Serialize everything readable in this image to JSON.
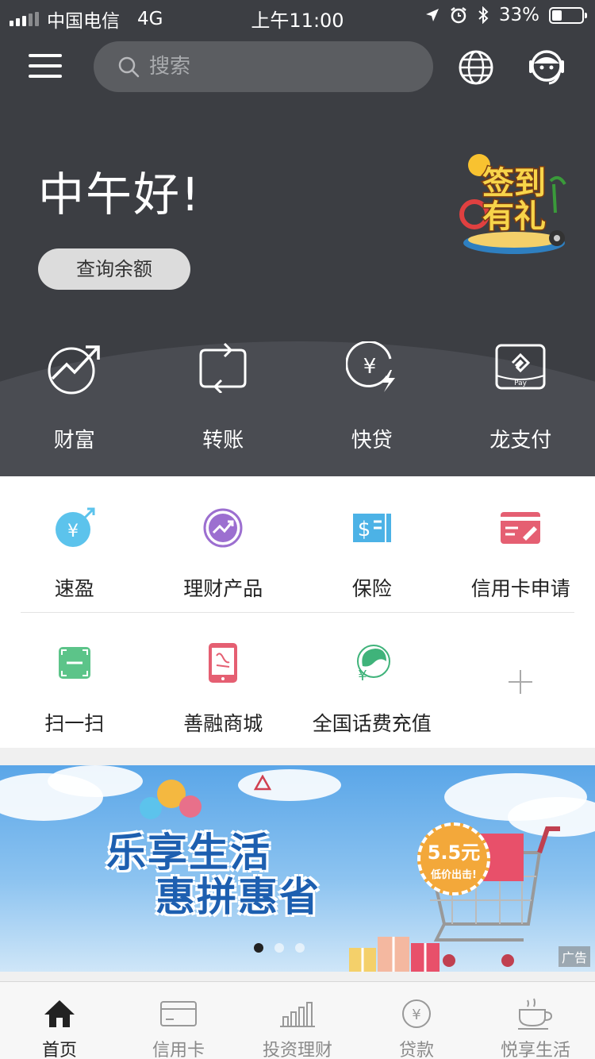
{
  "status_bar": {
    "carrier": "中国电信",
    "network": "4G",
    "time": "上午11:00",
    "battery": "33%",
    "battery_level": 0.33
  },
  "header": {
    "search_placeholder": "搜索"
  },
  "greeting": "中午好!",
  "balance_button": "查询余额",
  "promo_badge": {
    "line1": "签到",
    "line2": "有礼"
  },
  "quick_actions": [
    {
      "label": "财富",
      "icon": "wealth-chart-icon"
    },
    {
      "label": "转账",
      "icon": "transfer-icon"
    },
    {
      "label": "快贷",
      "icon": "quick-loan-icon"
    },
    {
      "label": "龙支付",
      "icon": "long-pay-icon"
    }
  ],
  "services": [
    {
      "label": "速盈",
      "icon": "quick-profit-icon",
      "color": "#5cc3ec"
    },
    {
      "label": "理财产品",
      "icon": "wealth-product-icon",
      "color": "#9c6fd0"
    },
    {
      "label": "保险",
      "icon": "insurance-icon",
      "color": "#4cb2e6"
    },
    {
      "label": "信用卡申请",
      "icon": "credit-card-apply-icon",
      "color": "#e55f72"
    },
    {
      "label": "扫一扫",
      "icon": "scan-icon",
      "color": "#5cc489"
    },
    {
      "label": "善融商城",
      "icon": "shanrong-mall-icon",
      "color": "#e55f72"
    },
    {
      "label": "全国话费充值",
      "icon": "phone-recharge-icon",
      "color": "#3fb37a"
    }
  ],
  "banner": {
    "title_line1": "乐享生活",
    "title_line2": "惠拼惠省",
    "price_big": "5.5元",
    "price_small": "低价出击!",
    "ad_label": "广告"
  },
  "tabbar": [
    {
      "label": "首页",
      "icon": "home-icon",
      "active": true
    },
    {
      "label": "信用卡",
      "icon": "credit-card-icon",
      "active": false
    },
    {
      "label": "投资理财",
      "icon": "investment-bars-icon",
      "active": false
    },
    {
      "label": "贷款",
      "icon": "loan-yen-icon",
      "active": false
    },
    {
      "label": "悦享生活",
      "icon": "coffee-cup-icon",
      "active": false
    }
  ],
  "colors": {
    "header_bg": "#3c3e43",
    "accent_green": "#5cc489",
    "accent_red": "#e55f72",
    "accent_blue": "#5cc3ec",
    "accent_purple": "#9c6fd0"
  }
}
